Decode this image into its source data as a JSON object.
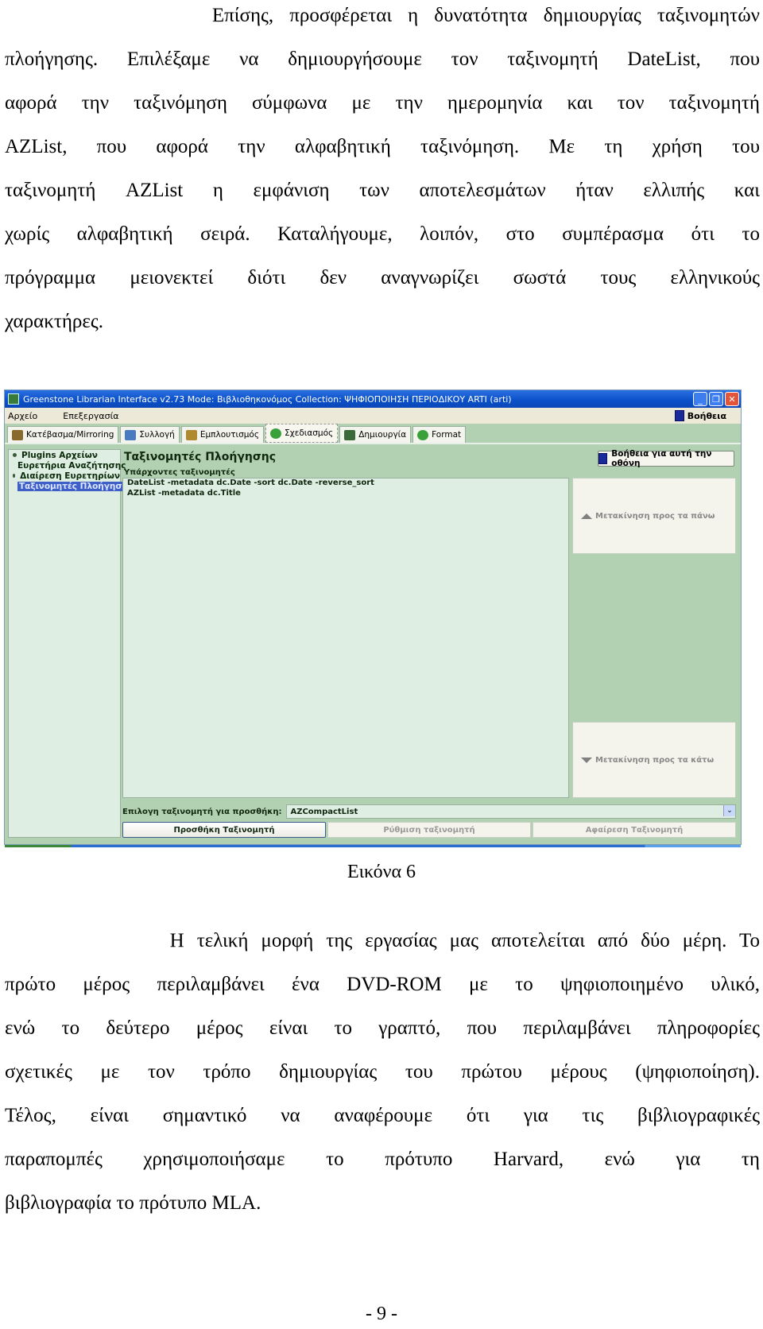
{
  "paragraph1": [
    "             Επίσης, προσφέρεται η δυνατότητα δημιουργίας ταξινομητών",
    "πλοήγησης. Επιλέξαμε να δημιουργήσουμε τον ταξινομητή DateList, που",
    "αφορά την ταξινόμηση σύμφωνα με την ημερομηνία και τον ταξινομητή",
    "AZList, που αφορά την αλφαβητική ταξινόμηση. Με τη χρήση του",
    "ταξινομητή AZList η εμφάνιση των αποτελεσμάτων ήταν ελλιπής και",
    "χωρίς αλφαβητική σειρά. Καταλήγουμε, λοιπόν, στο συμπέρασμα ότι το",
    "πρόγραμμα μειονεκτεί διότι δεν αναγνωρίζει σωστά τους ελληνικούς",
    "χαρακτήρες."
  ],
  "window": {
    "title": "Greenstone Librarian Interface v2.73  Mode: Βιβλιοθηκονόμος    Collection: ΨΗΦΙΟΠΟΙΗΣΗ ΠΕΡΙΟΔΙΚΟΥ ARTI (arti)",
    "controls": {
      "minimize": "_",
      "restore": "❐",
      "close": "✕"
    },
    "menu": [
      "Αρχείο",
      "Επεξεργασία"
    ],
    "help_menu": "Βοήθεια",
    "tabs": [
      {
        "label": "Κατέβασμα/Mirroring",
        "icon": "download-icon",
        "color": "#8a6a2a"
      },
      {
        "label": "Συλλογή",
        "icon": "collection-icon",
        "color": "#4a7ac0"
      },
      {
        "label": "Εμπλουτισμός",
        "icon": "enrich-icon",
        "color": "#b08a30"
      },
      {
        "label": "Σχεδιασμός",
        "icon": "gear-icon",
        "color": "#3aa03a",
        "active": true
      },
      {
        "label": "Δημιουργία",
        "icon": "build-icon",
        "color": "#3a6a3a"
      },
      {
        "label": "Format",
        "icon": "gear-icon",
        "color": "#3aa03a"
      }
    ],
    "sidebar": [
      {
        "label": "Plugins Αρχείων"
      },
      {
        "label": "Ευρετήρια Αναζήτησης"
      },
      {
        "label": "Διαίρεση Ευρετηρίων"
      },
      {
        "label": "Ταξινομητές Πλοήγησης",
        "selected": true
      }
    ],
    "content": {
      "title": "Ταξινομητές Πλοήγησης",
      "help_button": "Βοήθεια για αυτή την οθόνη",
      "existing_label": "Υπάρχοντες ταξινομητές",
      "classifiers": [
        "DateList -metadata dc.Date -sort dc.Date -reverse_sort",
        "AZList -metadata dc.Title"
      ],
      "move_up": "Μετακίνηση προς τα πάνω",
      "move_down": "Μετακίνηση προς τα κάτω",
      "select_label": "Επιλογη ταξινομητή για προσθήκη:",
      "select_value": "AZCompactList",
      "buttons": {
        "add": "Προσθήκη Ταξινομητή",
        "configure": "Ρύθμιση ταξινομητή",
        "remove": "Αφαίρεση Ταξινομητή"
      }
    }
  },
  "caption": "Εικόνα 6",
  "paragraph2": [
    "             Η τελική μορφή της εργασίας μας αποτελείται από δύο μέρη. Το",
    "πρώτο μέρος περιλαμβάνει ένα DVD-ROM με το ψηφιοποιημένο υλικό,",
    "ενώ το δεύτερο μέρος είναι το γραπτό, που περιλαμβάνει πληροφορίες",
    "σχετικές με τον τρόπο δημιουργίας του πρώτου μέρους (ψηφιοποίηση).",
    "Τέλος, είναι σημαντικό να αναφέρουμε ότι για τις βιβλιογραφικές",
    "παραπομπές χρησιμοποιήσαμε το πρότυπο Harvard, ενώ για τη",
    "βιβλιογραφία το πρότυπο MLA."
  ],
  "page_number": "- 9 -"
}
